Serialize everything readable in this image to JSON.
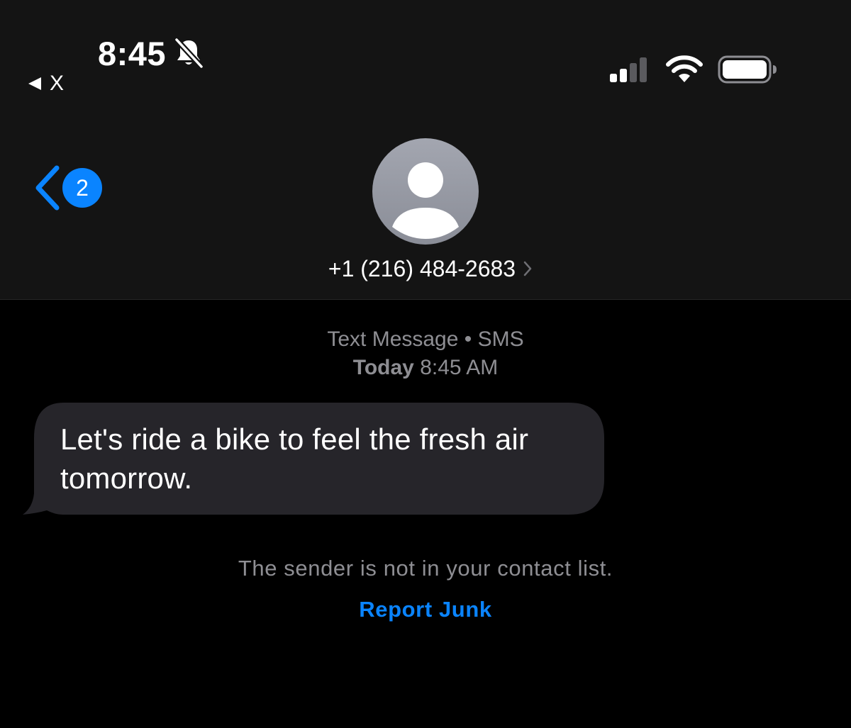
{
  "status_bar": {
    "time": "8:45",
    "back_app_label": "X",
    "icons": [
      "bell-slash-icon",
      "back-triangle-icon",
      "cellular-signal-icon",
      "wifi-icon",
      "battery-icon"
    ]
  },
  "nav": {
    "back_badge": "2",
    "contact": "+1 (216) 484-2683"
  },
  "conversation": {
    "service": "Text Message",
    "separator": "•",
    "service_type": "SMS",
    "day": "Today",
    "time": "8:45 AM",
    "messages": [
      {
        "direction": "incoming",
        "text": "Let's ride a bike to feel the fresh air tomorrow."
      }
    ],
    "notice": "The sender is not in your contact list.",
    "report_action": "Report Junk"
  },
  "colors": {
    "accent": "#0a84ff",
    "header_bg": "#141414",
    "bubble_bg": "#26252a",
    "secondary_text": "#8e8e93",
    "background": "#000000"
  }
}
